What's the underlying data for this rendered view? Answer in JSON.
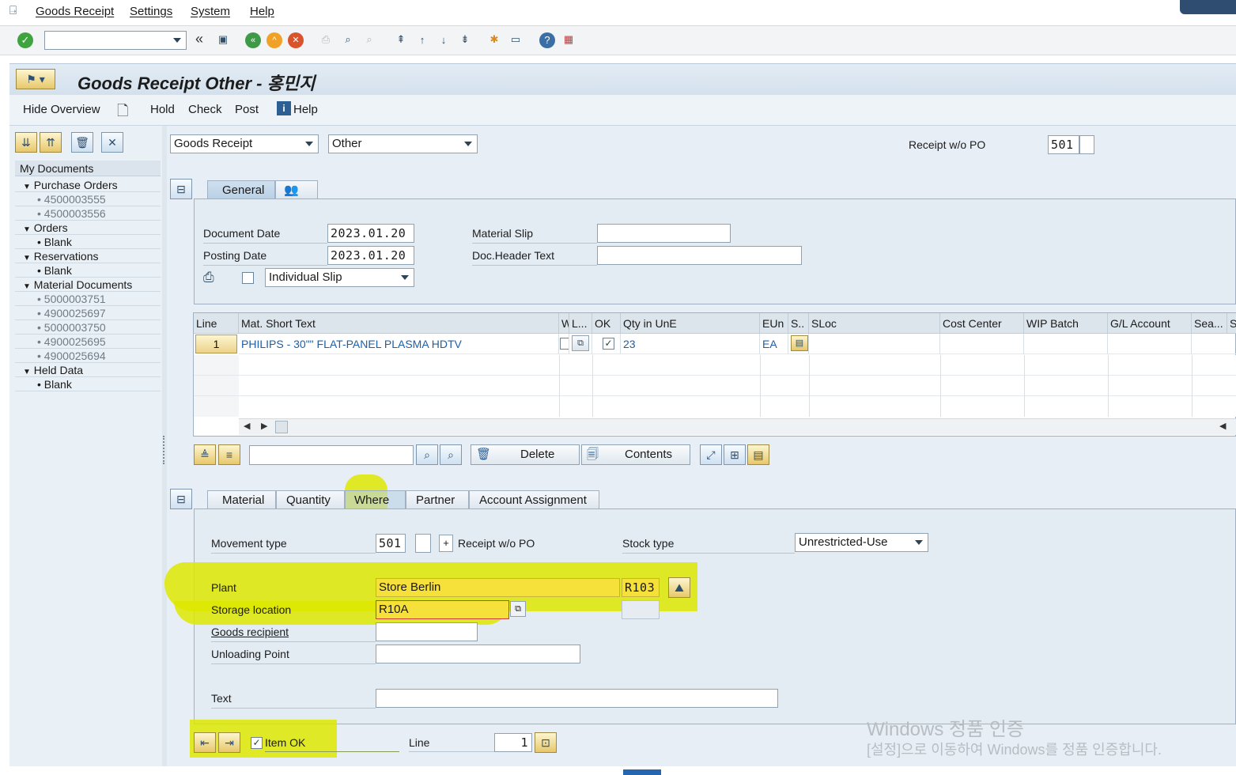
{
  "menu": {
    "items": [
      "Goods Receipt",
      "Settings",
      "System",
      "Help"
    ]
  },
  "toolbar": {
    "command_value": ""
  },
  "title": "Goods Receipt Other - 홍민지",
  "app_toolbar": {
    "hide_overview": "Hide Overview",
    "hold": "Hold",
    "check": "Check",
    "post": "Post",
    "help": "Help"
  },
  "left": {
    "header": "My Documents",
    "groups": [
      {
        "label": "Purchase Orders",
        "items": [
          "4500003555",
          "4500003556"
        ]
      },
      {
        "label": "Orders",
        "items": [
          "Blank"
        ]
      },
      {
        "label": "Reservations",
        "items": [
          "Blank"
        ]
      },
      {
        "label": "Material Documents",
        "items": [
          "5000003751",
          "4900025697",
          "5000003750",
          "4900025695",
          "4900025694"
        ]
      },
      {
        "label": "Held Data",
        "items": [
          "Blank"
        ]
      }
    ]
  },
  "header": {
    "transaction": "Goods Receipt",
    "reference": "Other",
    "receipt_label": "Receipt w/o PO",
    "movement_type": "501"
  },
  "general": {
    "tabs": [
      "General"
    ],
    "document_date_label": "Document Date",
    "document_date": "2023.01.20",
    "posting_date_label": "Posting Date",
    "posting_date": "2023.01.20",
    "material_slip_label": "Material Slip",
    "material_slip": "",
    "doc_header_text_label": "Doc.Header Text",
    "doc_header_text": "",
    "slip_option": "Individual Slip"
  },
  "grid": {
    "columns": [
      "Line",
      "Mat. Short Text",
      "W",
      "L...",
      "OK",
      "Qty in UnE",
      "EUn",
      "S..",
      "SLoc",
      "Cost Center",
      "WIP Batch",
      "G/L Account",
      "Sea...",
      "S"
    ],
    "rows": [
      {
        "line": "1",
        "text": "PHILIPS - 30\"\" FLAT-PANEL PLASMA HDTV",
        "ok": "✓",
        "qty": "23",
        "eun": "EA"
      }
    ]
  },
  "grid_toolbar": {
    "delete": "Delete",
    "contents": "Contents",
    "search_value": ""
  },
  "detail": {
    "tabs": [
      "Material",
      "Quantity",
      "Where",
      "Partner",
      "Account Assignment"
    ],
    "active_tab": "Where",
    "movement_type_label": "Movement type",
    "movement_type": "501",
    "movement_plus": "+",
    "movement_text": "Receipt w/o PO",
    "stock_type_label": "Stock type",
    "stock_type": "Unrestricted-Use",
    "plant_label": "Plant",
    "plant_name": "Store Berlin",
    "plant_code": "R103",
    "storage_location_label": "Storage location",
    "storage_location": "R10A",
    "goods_recipient_label": "Goods recipient",
    "goods_recipient": "",
    "unloading_point_label": "Unloading Point",
    "unloading_point": "",
    "text_label": "Text",
    "text": ""
  },
  "footer": {
    "item_ok_label": "Item OK",
    "item_ok": "✓",
    "line_label": "Line",
    "line_value": "1"
  },
  "watermark": {
    "line1": "Windows 정품 인증",
    "line2": "[설정]으로 이동하여 Windows를 정품 인증합니다."
  },
  "colors": {
    "highlight": "#dee800",
    "accent": "#1d5fa8",
    "panel": "#e7eef5"
  }
}
